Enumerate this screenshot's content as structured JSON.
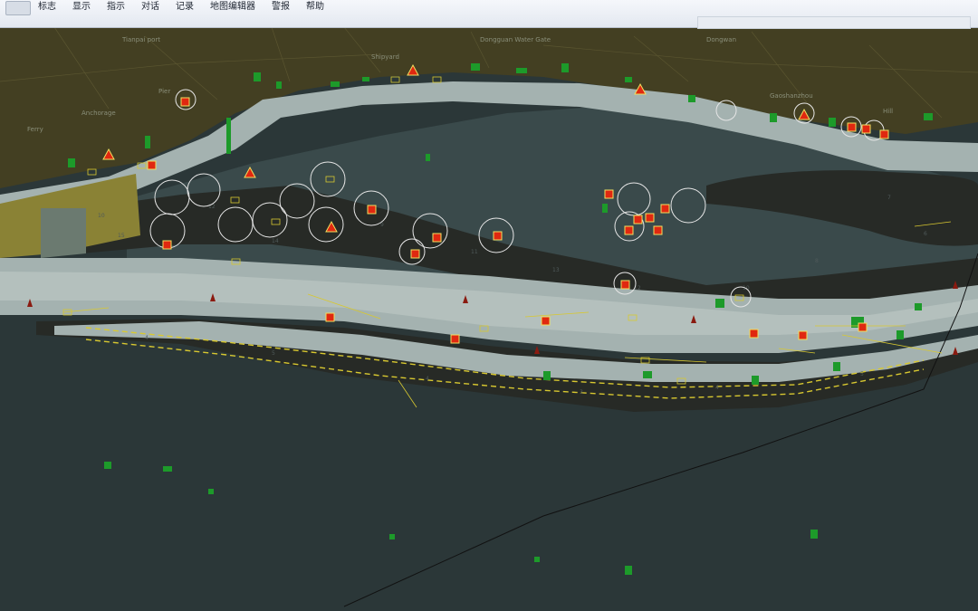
{
  "menu": {
    "items": [
      "标志",
      "显示",
      "指示",
      "对话",
      "记录",
      "地图编辑器",
      "警报",
      "帮助"
    ]
  },
  "colors": {
    "land": "#433f22",
    "deep_water": "#2b3738",
    "mid_water": "#3a4a4b",
    "shoal_band": "#a4b2b0",
    "channel_dark": "#272a26",
    "vegetation": "#1d9a2a",
    "alert_red": "#e02810",
    "alert_orange": "#e8a020",
    "yellow_line": "#d8c830",
    "ring": "#e6e6e6"
  },
  "icons": [
    "app-icon",
    "buoy-marker-icon",
    "alert-triangle-icon",
    "alert-square-icon",
    "range-ring-icon"
  ]
}
